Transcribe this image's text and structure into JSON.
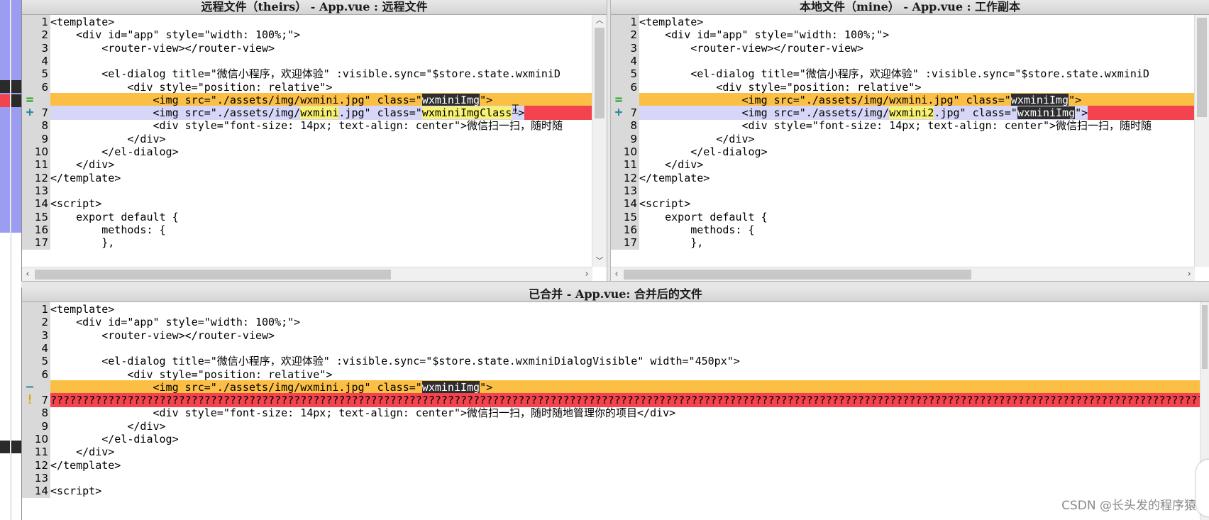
{
  "panes": {
    "theirs": {
      "title": "远程文件（theirs） - App.vue : 远程文件",
      "lines": [
        {
          "num": "1",
          "text": "<template>",
          "hl": "",
          "marker": "",
          "mcolor": ""
        },
        {
          "num": "2",
          "text": "    <div id=\"app\" style=\"width: 100%;\">",
          "hl": "",
          "marker": "",
          "mcolor": ""
        },
        {
          "num": "3",
          "text": "        <router-view></router-view>",
          "hl": "",
          "marker": "",
          "mcolor": ""
        },
        {
          "num": "4",
          "text": "",
          "hl": "",
          "marker": "",
          "mcolor": ""
        },
        {
          "num": "5",
          "text": "        <el-dialog title=\"微信小程序，欢迎体验\" :visible.sync=\"$store.state.wxminiD",
          "hl": "",
          "marker": "",
          "mcolor": ""
        },
        {
          "num": "6",
          "text": "            <div style=\"position: relative\">",
          "hl": "",
          "marker": "",
          "mcolor": ""
        },
        {
          "num": "",
          "hl": "orange",
          "marker": "=",
          "mcolor": "#23a623",
          "segments": [
            {
              "t": "                <img src=\"./assets/img/wxmini.jpg\" class=\""
            },
            {
              "t": "wxminiImg",
              "c": "dark"
            },
            {
              "t": "\">"
            }
          ]
        },
        {
          "num": "7",
          "hl": "blue",
          "marker": "+",
          "mcolor": "#2a8a9a",
          "redtail": true,
          "segments": [
            {
              "t": "                <img src=\"./assets/img/"
            },
            {
              "t": "wxmini",
              "c": "yellow"
            },
            {
              "t": ".jpg\" class=\""
            },
            {
              "t": "wxminiImgClass",
              "c": "yellow"
            },
            {
              "t": "\">"
            }
          ]
        },
        {
          "num": "8",
          "text": "                <div style=\"font-size: 14px; text-align: center\">微信扫一扫，随时随",
          "hl": "",
          "marker": "",
          "mcolor": ""
        },
        {
          "num": "9",
          "text": "            </div>",
          "hl": "",
          "marker": "",
          "mcolor": ""
        },
        {
          "num": "10",
          "text": "        </el-dialog>",
          "hl": "",
          "marker": "",
          "mcolor": ""
        },
        {
          "num": "11",
          "text": "    </div>",
          "hl": "",
          "marker": "",
          "mcolor": ""
        },
        {
          "num": "12",
          "text": "</template>",
          "hl": "",
          "marker": "",
          "mcolor": ""
        },
        {
          "num": "13",
          "text": "",
          "hl": "",
          "marker": "",
          "mcolor": ""
        },
        {
          "num": "14",
          "text": "<script>",
          "hl": "",
          "marker": "",
          "mcolor": ""
        },
        {
          "num": "15",
          "text": "    export default {",
          "hl": "",
          "marker": "",
          "mcolor": ""
        },
        {
          "num": "16",
          "text": "        methods: {",
          "hl": "",
          "marker": "",
          "mcolor": ""
        },
        {
          "num": "17",
          "text": "        },",
          "hl": "",
          "marker": "",
          "mcolor": ""
        }
      ]
    },
    "mine": {
      "title": "本地文件（mine） - App.vue : 工作副本",
      "lines": [
        {
          "num": "1",
          "text": "<template>",
          "hl": "",
          "marker": "",
          "mcolor": ""
        },
        {
          "num": "2",
          "text": "    <div id=\"app\" style=\"width: 100%;\">",
          "hl": "",
          "marker": "",
          "mcolor": ""
        },
        {
          "num": "3",
          "text": "        <router-view></router-view>",
          "hl": "",
          "marker": "",
          "mcolor": ""
        },
        {
          "num": "4",
          "text": "",
          "hl": "",
          "marker": "",
          "mcolor": ""
        },
        {
          "num": "5",
          "text": "        <el-dialog title=\"微信小程序，欢迎体验\" :visible.sync=\"$store.state.wxminiD",
          "hl": "",
          "marker": "",
          "mcolor": ""
        },
        {
          "num": "6",
          "text": "            <div style=\"position: relative\">",
          "hl": "",
          "marker": "",
          "mcolor": ""
        },
        {
          "num": "",
          "hl": "orange",
          "marker": "=",
          "mcolor": "#23a623",
          "segments": [
            {
              "t": "                <img src=\"./assets/img/wxmini.jpg\" class=\""
            },
            {
              "t": "wxminiImg",
              "c": "dark"
            },
            {
              "t": "\">"
            }
          ]
        },
        {
          "num": "7",
          "hl": "blue",
          "marker": "+",
          "mcolor": "#2a8a9a",
          "redtail": true,
          "segments": [
            {
              "t": "                <img src=\"./assets/img/"
            },
            {
              "t": "wxmini2",
              "c": "yellow"
            },
            {
              "t": ".jpg\" class=\""
            },
            {
              "t": "wxminiImg",
              "c": "dark"
            },
            {
              "t": "\">"
            }
          ]
        },
        {
          "num": "8",
          "text": "                <div style=\"font-size: 14px; text-align: center\">微信扫一扫，随时随",
          "hl": "",
          "marker": "",
          "mcolor": ""
        },
        {
          "num": "9",
          "text": "            </div>",
          "hl": "",
          "marker": "",
          "mcolor": ""
        },
        {
          "num": "10",
          "text": "        </el-dialog>",
          "hl": "",
          "marker": "",
          "mcolor": ""
        },
        {
          "num": "11",
          "text": "    </div>",
          "hl": "",
          "marker": "",
          "mcolor": ""
        },
        {
          "num": "12",
          "text": "</template>",
          "hl": "",
          "marker": "",
          "mcolor": ""
        },
        {
          "num": "13",
          "text": "",
          "hl": "",
          "marker": "",
          "mcolor": ""
        },
        {
          "num": "14",
          "text": "<script>",
          "hl": "",
          "marker": "",
          "mcolor": ""
        },
        {
          "num": "15",
          "text": "    export default {",
          "hl": "",
          "marker": "",
          "mcolor": ""
        },
        {
          "num": "16",
          "text": "        methods: {",
          "hl": "",
          "marker": "",
          "mcolor": ""
        },
        {
          "num": "17",
          "text": "        },",
          "hl": "",
          "marker": "",
          "mcolor": ""
        }
      ]
    },
    "merged": {
      "title": "已合并 - App.vue: 合并后的文件",
      "lines": [
        {
          "num": "1",
          "text": "<template>",
          "hl": "",
          "marker": "",
          "mcolor": ""
        },
        {
          "num": "2",
          "text": "    <div id=\"app\" style=\"width: 100%;\">",
          "hl": "",
          "marker": "",
          "mcolor": ""
        },
        {
          "num": "3",
          "text": "        <router-view></router-view>",
          "hl": "",
          "marker": "",
          "mcolor": ""
        },
        {
          "num": "4",
          "text": "",
          "hl": "",
          "marker": "",
          "mcolor": ""
        },
        {
          "num": "5",
          "text": "        <el-dialog title=\"微信小程序，欢迎体验\" :visible.sync=\"$store.state.wxminiDialogVisible\" width=\"450px\">",
          "hl": "",
          "marker": "",
          "mcolor": ""
        },
        {
          "num": "6",
          "text": "            <div style=\"position: relative\">",
          "hl": "",
          "marker": "",
          "mcolor": ""
        },
        {
          "num": "",
          "hl": "orange",
          "marker": "−",
          "mcolor": "#2a8a9a",
          "segments": [
            {
              "t": "                <img src=\"./assets/img/wxmini.jpg\" class=\""
            },
            {
              "t": "wxminiImg",
              "c": "dark"
            },
            {
              "t": "\">"
            }
          ]
        },
        {
          "num": "7",
          "text": "?????????????????????????????????????????????????????????????????????????????????????????????????????????????????????????????????????????????????????????????????????????????????????????",
          "hl": "red",
          "marker": "!",
          "mcolor": "#e0a800"
        },
        {
          "num": "8",
          "text": "                <div style=\"font-size: 14px; text-align: center\">微信扫一扫，随时随地管理你的项目</div>",
          "hl": "",
          "marker": "",
          "mcolor": ""
        },
        {
          "num": "9",
          "text": "            </div>",
          "hl": "",
          "marker": "",
          "mcolor": ""
        },
        {
          "num": "10",
          "text": "        </el-dialog>",
          "hl": "",
          "marker": "",
          "mcolor": ""
        },
        {
          "num": "11",
          "text": "    </div>",
          "hl": "",
          "marker": "",
          "mcolor": ""
        },
        {
          "num": "12",
          "text": "</template>",
          "hl": "",
          "marker": "",
          "mcolor": ""
        },
        {
          "num": "13",
          "text": "",
          "hl": "",
          "marker": "",
          "mcolor": ""
        },
        {
          "num": "14",
          "text": "<script>",
          "hl": "",
          "marker": "",
          "mcolor": ""
        }
      ]
    }
  },
  "scroll": {
    "up": "︿",
    "down": "﹀",
    "left": "‹",
    "right": "›"
  },
  "watermark": "CSDN @长头发的程序猿",
  "colors": {
    "conflict_orange": "#fbbf45",
    "change_blue": "#d6d6f8",
    "conflict_red": "#f2434f",
    "gutter": "#d9d9d9",
    "strip_purple": "#9b9df2"
  }
}
